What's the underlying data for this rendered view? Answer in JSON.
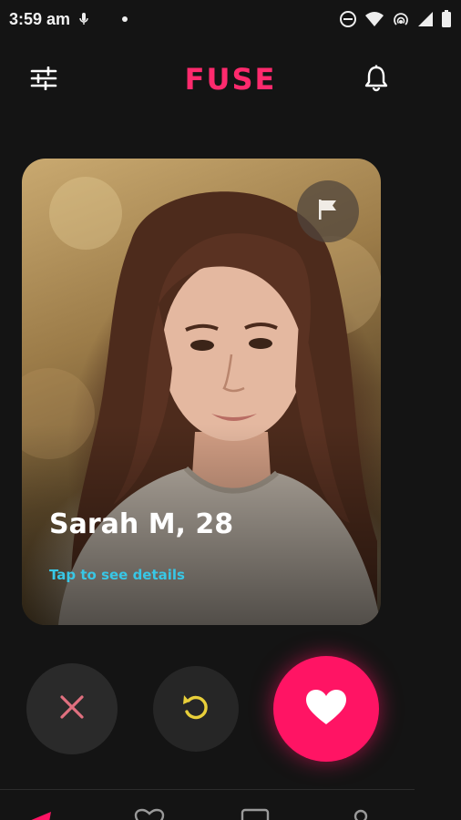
{
  "status_bar": {
    "time": "3:59 am",
    "icons": [
      "mic-icon",
      "dot-icon",
      "do-not-disturb-icon",
      "wifi-icon",
      "hotspot-icon",
      "signal-icon",
      "battery-icon"
    ]
  },
  "header": {
    "brand": "FUSE",
    "left_icon": "filter-sliders-icon",
    "right_icon": "bell-icon"
  },
  "card": {
    "name_age": "Sarah M, 28",
    "details_link": "Tap to see details",
    "report_icon": "flag-icon"
  },
  "actions": {
    "dislike_icon": "close-icon",
    "undo_icon": "undo-icon",
    "like_icon": "heart-icon"
  },
  "bottom_nav": {
    "items": [
      "discover-icon",
      "likes-icon",
      "messages-icon",
      "profile-icon"
    ]
  },
  "colors": {
    "background": "#141414",
    "brand": "#ff2a6d",
    "like_button": "#ff1464",
    "link": "#38c7e6",
    "dislike_x": "#e0707f",
    "undo": "#e8cf3a"
  }
}
